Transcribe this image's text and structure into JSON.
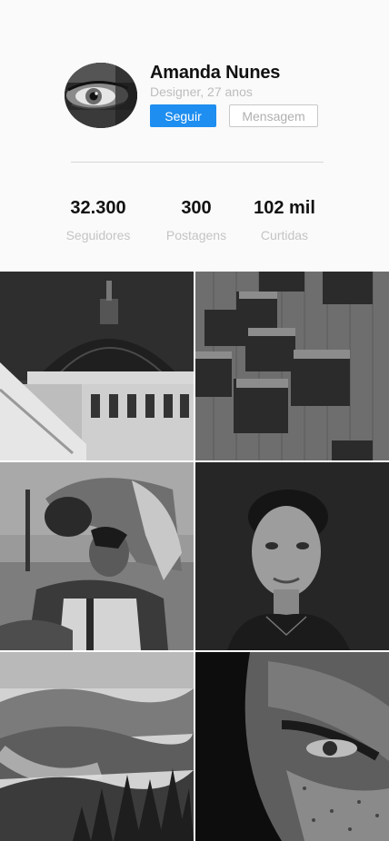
{
  "profile": {
    "name": "Amanda Nunes",
    "subtitle": "Designer, 27 anos",
    "follow_label": "Seguir",
    "message_label": "Mensagem",
    "accent_color": "#1e8ef0"
  },
  "stats": [
    {
      "value": "32.300",
      "label": "Seguidores"
    },
    {
      "value": "300",
      "label": "Postagens"
    },
    {
      "value": "102 mil",
      "label": "Curtidas"
    }
  ],
  "gallery": [
    {
      "subject": "domed-building-photo"
    },
    {
      "subject": "geometric-facade-photo"
    },
    {
      "subject": "couple-photo"
    },
    {
      "subject": "woman-portrait-photo"
    },
    {
      "subject": "misty-forest-photo"
    },
    {
      "subject": "eye-closeup-photo"
    }
  ]
}
